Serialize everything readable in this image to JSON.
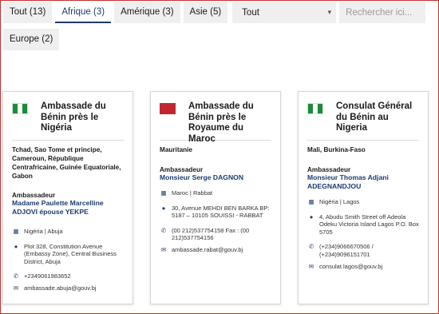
{
  "filters": {
    "tabs": [
      {
        "label": "Tout (13)",
        "active": false
      },
      {
        "label": "Afrique (3)",
        "active": true
      },
      {
        "label": "Amérique (3)",
        "active": false
      },
      {
        "label": "Asie (5)",
        "active": false
      },
      {
        "label": "Europe (2)",
        "active": false
      }
    ],
    "select_value": "Tout",
    "search_placeholder": "Rechercher ici..."
  },
  "cards": [
    {
      "flag": "nigeria-flag",
      "title": "Ambassade du Bénin près le Nigéria",
      "countries": "Tchad, Sao Tome et principe, Cameroun, République Centrafricaine, Guinée Equatoriale, Gabon",
      "ambassador_label": "Ambassadeur",
      "ambassador_name": "Madame Paulette Marcelline ADJOVI épouse YEKPE",
      "location": "Nigéria | Abuja",
      "address": "Plot 328, Constitution Avenue (Embassy Zone), Central Business District, Abuja",
      "phone": "+2349061983652",
      "email": "ambassade.abuja@gouv.bj"
    },
    {
      "flag": "morocco-flag",
      "title": "Ambassade du Bénin près le Royaume du Maroc",
      "countries": "Mauritanie",
      "ambassador_label": "Ambassadeur",
      "ambassador_name": "Monsieur Serge DAGNON",
      "location": "Maroc | Rabbat",
      "address": "30, Avenue MEHDI BEN BARKA BP: 5187 – 10105 SOUISSI - RABBAT",
      "phone": "(00 212)537754158 Fax : (00 212)537754156",
      "email": "ambassade.rabat@gouv.bj"
    },
    {
      "flag": "nigeria-flag",
      "title": "Consulat Général du Bénin au Nigeria",
      "countries": "Mali, Burkina-Faso",
      "ambassador_label": "Ambassadeur",
      "ambassador_name": "Monsieur Thomas Adjani ADEGNANDJOU",
      "location": "Nigéria | Lagos",
      "address": "4, Abudu Smith Street off Adeola Odeku Victoria Island Lagos P.O. Box 5705",
      "phone": "(+234)9066670506 / (+234)9096151701",
      "email": "consulat.lagos@gouv.bj"
    }
  ],
  "icons": {
    "building": "building-icon",
    "pin": "location-pin-icon",
    "phone": "phone-icon",
    "mail": "mail-icon",
    "chevron": "chevron-down-icon"
  }
}
